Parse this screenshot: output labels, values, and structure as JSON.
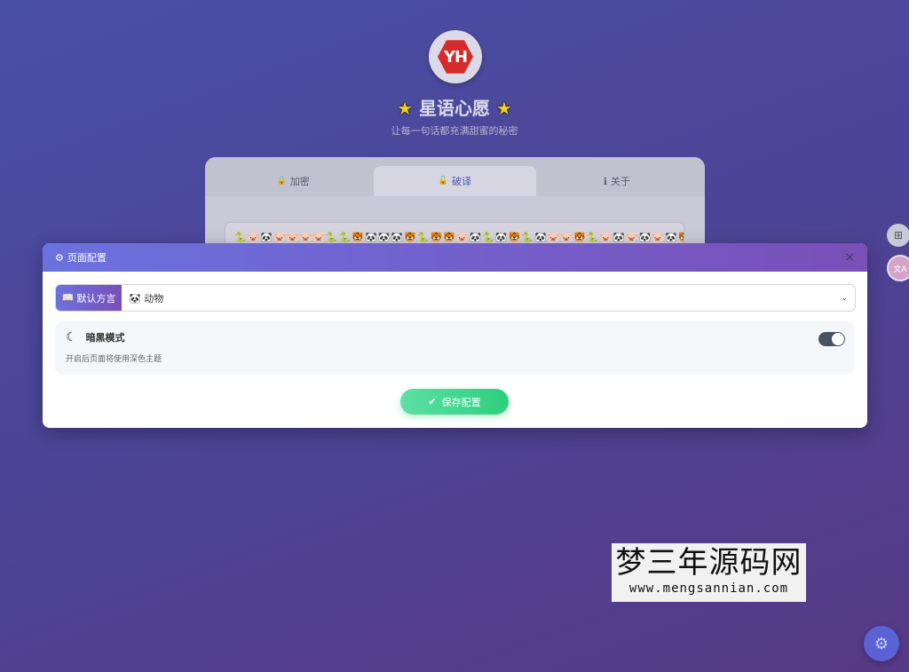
{
  "header": {
    "logo_text": "YH",
    "title": "星语心愿",
    "title_star": "★",
    "subtitle": "让每一句话都充满甜蜜的秘密"
  },
  "tabs": [
    {
      "icon": "🔒",
      "label": "加密"
    },
    {
      "icon": "🔓",
      "label": "破译"
    },
    {
      "icon": "ℹ",
      "label": "关于"
    }
  ],
  "cipher_text": "🐍🐷🐼🐷🐷🐷🐷🐍🐍🐯🐼🐼🐼🐯🐍🐯🐯🐷🐼🐍🐼🐯🐍🐼🐷🐷🐯🐍🐷🐼🐷🐼🐷🐼🐯",
  "side_buttons": {
    "top_icon": "⊞",
    "bottom_icon": "文A"
  },
  "modal": {
    "title": "页面配置",
    "close_icon": "×",
    "dialect": {
      "label": "默认方言",
      "selected_icon": "🐼",
      "selected": "动物"
    },
    "dark_mode": {
      "label": "暗黑模式",
      "description": "开启后页面将使用深色主题",
      "enabled": true
    },
    "save_label": "保存配置"
  },
  "watermark": {
    "text": "梦三年源码网",
    "url": "www.mengsannian.com"
  },
  "fab_icon": "⚙",
  "colors": {
    "accent_start": "#6a72df",
    "accent_end": "#7b4fb8",
    "save_green": "#2dcf7d",
    "logo_red": "#d62b2b"
  }
}
